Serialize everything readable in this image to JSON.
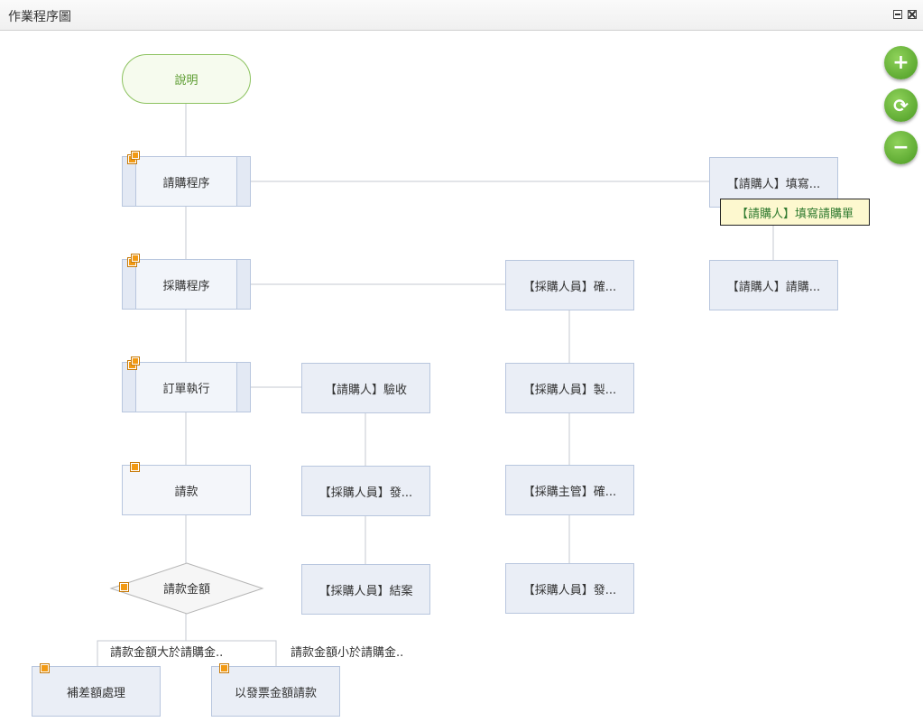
{
  "window": {
    "title": "作業程序圖",
    "minimize_icon": "minimize-icon",
    "close_icon": "close-icon"
  },
  "zoom_controls": {
    "zoom_in_icon": "plus-icon",
    "reset_icon": "refresh-icon",
    "zoom_out_icon": "minus-icon",
    "zoom_in_glyph": "+",
    "reset_glyph": "⟳",
    "zoom_out_glyph": "−"
  },
  "flow": {
    "start": "說明",
    "main_steps": [
      "請購程序",
      "採購程序",
      "訂單執行",
      "請款"
    ],
    "decision": "請款金額",
    "branch_labels": [
      "請款金額大於請購金..",
      "請款金額小於請購金.."
    ],
    "branch_targets": [
      "補差額處理",
      "以發票金額請款"
    ],
    "request_branch": [
      "【請購人】填寫...",
      "【請購人】請購..."
    ],
    "purchase_branch": [
      "【採購人員】確...",
      "【採購人員】製...",
      "【採購主管】確...",
      "【採購人員】發..."
    ],
    "order_branch": [
      "【請購人】驗收",
      "【採購人員】發...",
      "【採購人員】結案"
    ]
  },
  "tooltip": {
    "text": "【請購人】填寫請購單"
  },
  "colors": {
    "node_fill": "#eaeef6",
    "node_border": "#b8c6de",
    "start_border": "#8cc25f",
    "marker": "#f29a14",
    "zoom_button": "#5aab2c",
    "tooltip_fill": "#fdf8cf",
    "tooltip_text": "#2f7a2f"
  }
}
